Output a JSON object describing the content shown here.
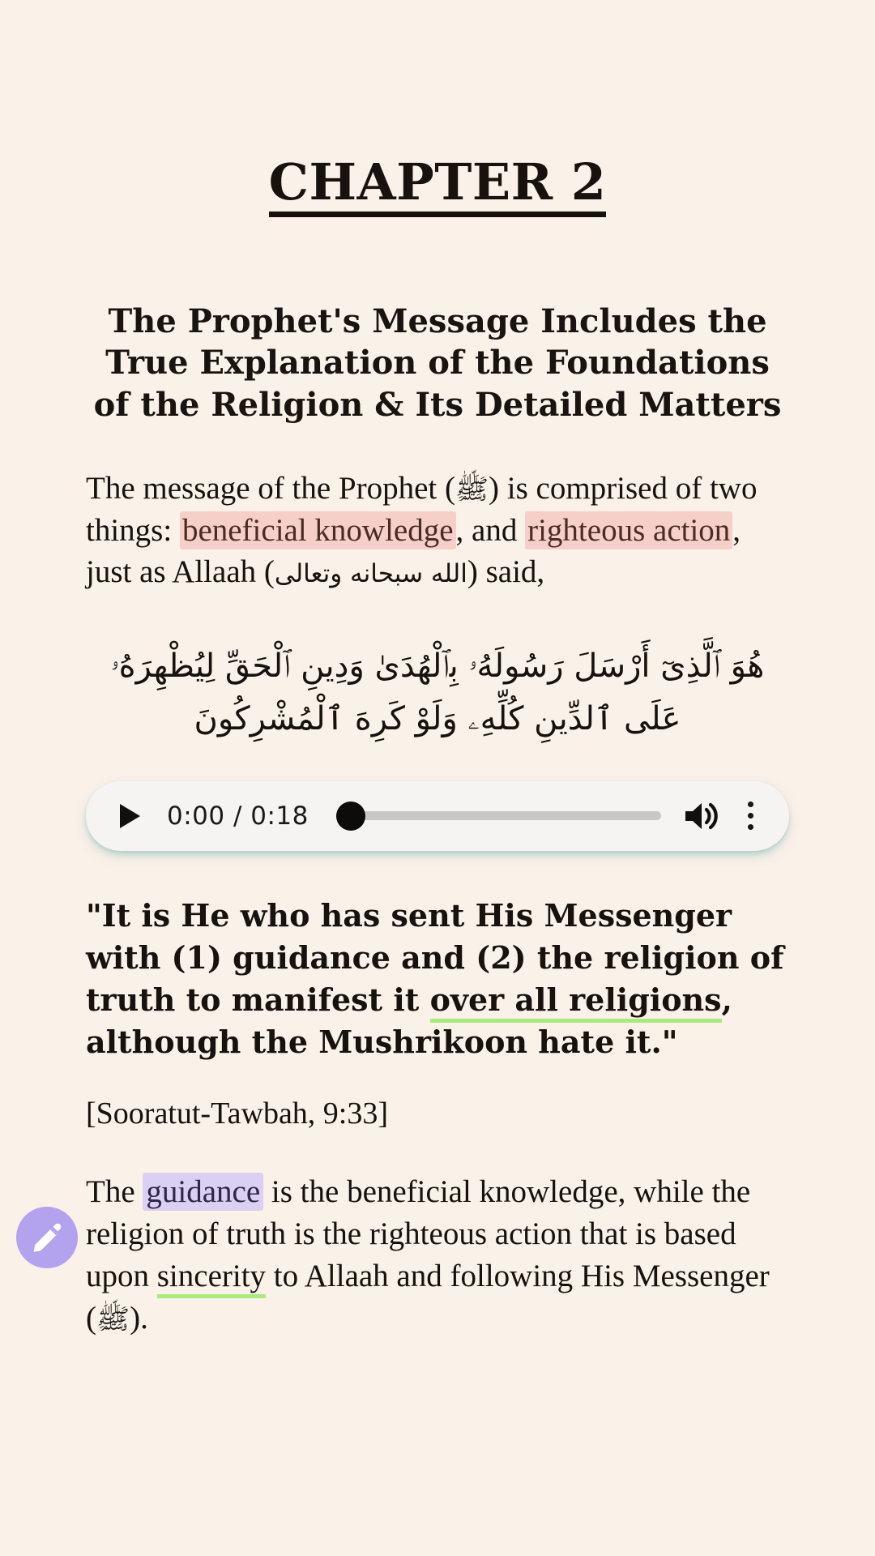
{
  "theme": {
    "background": "#faf1e9",
    "text": "#17120e",
    "highlight_pink": "#f6cfc9",
    "highlight_purple": "#d9d0f2",
    "underline_green": "#a9ea7c",
    "fab_purple": "#b3a3ee",
    "player_background": "#f5f4f2",
    "player_glow": "#5aaaa8"
  },
  "chapter": {
    "title": "CHAPTER 2",
    "subtitle": "The Prophet's Message Includes the True Explanation of the Foundations of the Religion & Its Detailed Matters"
  },
  "intro_paragraph": {
    "part1": "The message of the Prophet (",
    "sallallahu_glyph": "ﷺ",
    "part2": ") is comprised of two things: ",
    "highlight1": "beneficial knowledge",
    "part3": ", and ",
    "highlight2": "righteous action",
    "part4": ", just as Allaah (",
    "arabic_honorific": "الله سبحانه وتعالى",
    "part5": ") said,"
  },
  "ayah": {
    "line1": "هُوَ ٱلَّذِىٓ أَرْسَلَ رَسُولَهُۥ بِٱلْهُدَىٰ وَدِينِ ٱلْحَقِّ لِيُظْهِرَهُۥ",
    "line2": "عَلَى ٱلدِّينِ كُلِّهِۦ وَلَوْ كَرِهَ ٱلْمُشْرِكُونَ"
  },
  "audio_player": {
    "play_label": "play",
    "current_time": "0:00",
    "duration": "0:18",
    "time_display": "0:00 / 0:18",
    "progress_percent": 2,
    "volume_label": "volume",
    "menu_label": "more options"
  },
  "translation_quote": {
    "part1": "\"It is He who has sent His Messenger with (1) guidance and (2) the religion of truth to manifest it ",
    "underlined": "over all religions",
    "part2": ", although the Mushrikoon hate it.\"",
    "citation": "[Sooratut-Tawbah, 9:33]"
  },
  "explanation_paragraph": {
    "part1": "The ",
    "highlight1": "guidance",
    "part2": " is the beneficial knowledge, while the religion of truth is the righteous action that is based upon ",
    "underlined": "sincerity",
    "part3": " to Allaah and following His Messenger (",
    "sallallahu_glyph": "ﷺ",
    "part4": ")."
  },
  "fab": {
    "label": "edit",
    "icon": "pencil-icon"
  }
}
